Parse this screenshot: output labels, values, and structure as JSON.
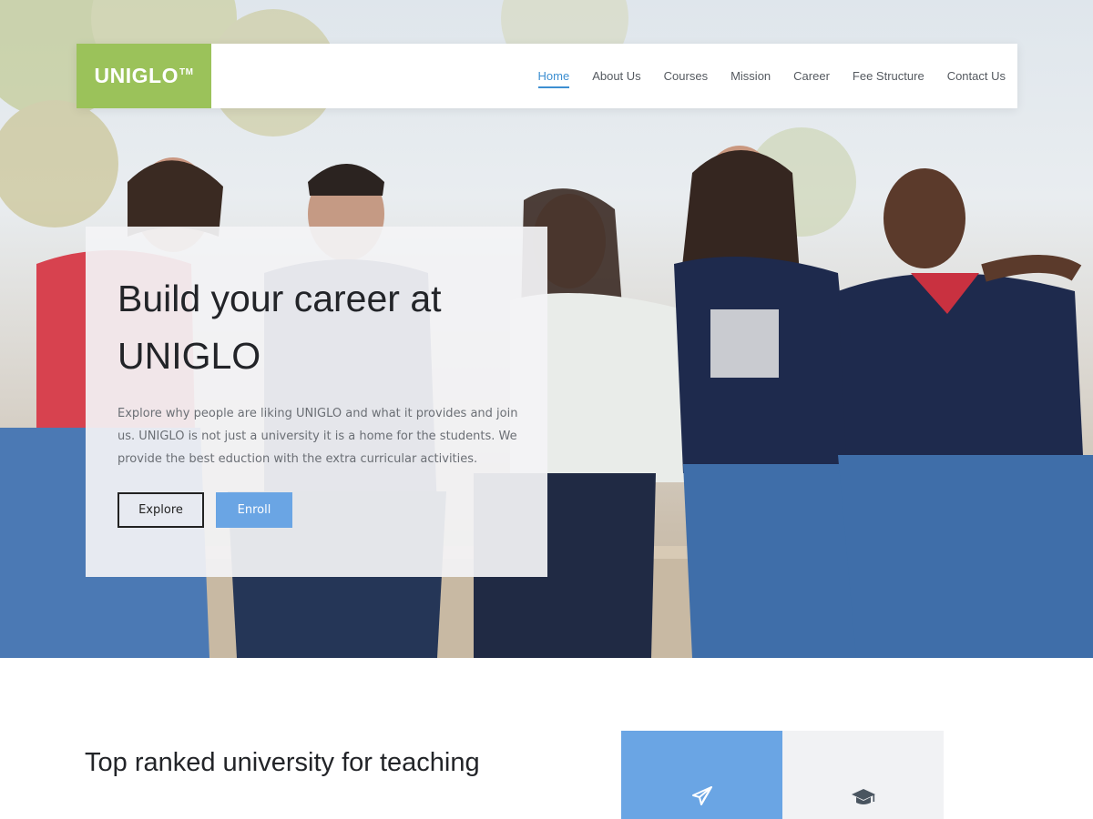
{
  "brand": {
    "name": "UNIGLO",
    "trademark": "TM",
    "color": "#9bc25a"
  },
  "nav": {
    "items": [
      {
        "label": "Home",
        "active": true
      },
      {
        "label": "About Us",
        "active": false
      },
      {
        "label": "Courses",
        "active": false
      },
      {
        "label": "Mission",
        "active": false
      },
      {
        "label": "Career",
        "active": false
      },
      {
        "label": "Fee Structure",
        "active": false
      },
      {
        "label": "Contact Us",
        "active": false
      }
    ],
    "active_color": "#3d8fd1"
  },
  "hero": {
    "title": "Build your career at UNIGLO",
    "description": "Explore why people are liking UNIGLO and what it provides and join us. UNIGLO is not just a university it is a home for the students. We provide the best eduction with the extra curricular activities.",
    "explore_label": "Explore",
    "enroll_label": "Enroll",
    "enroll_color": "#6aa5e4"
  },
  "section": {
    "title": "Top ranked university for teaching"
  },
  "features": [
    {
      "icon": "paper-plane-icon",
      "color": "#6aa5e4"
    },
    {
      "icon": "graduation-cap-icon",
      "color": "#f1f2f4"
    }
  ]
}
